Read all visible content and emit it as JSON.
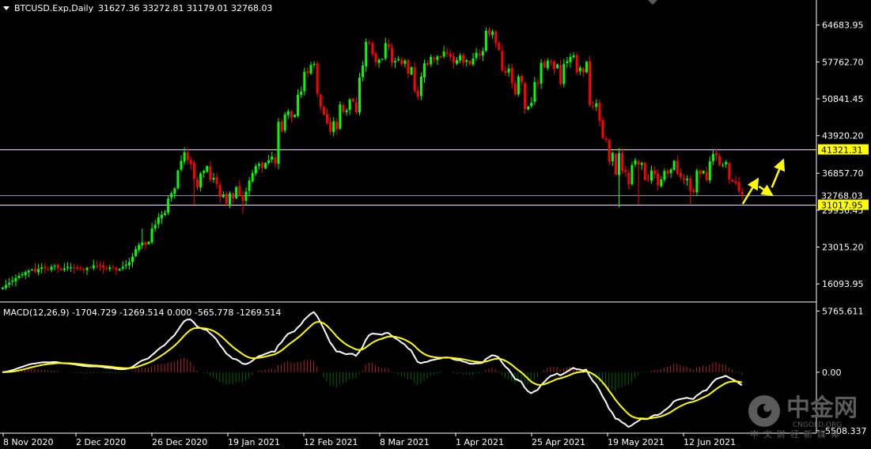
{
  "header": {
    "symbol": "BTCUSD.Exp,Daily",
    "ohlc": "31627.36 33272.81 31179.01 32768.03",
    "macd": "MACD(12,26,9) -1704.729 -1269.514 0.000 -565.778 -1269.514"
  },
  "watermark": {
    "name": "中金网",
    "domain": "CNGOLD.ORG",
    "tagline": "中文财经新媒体"
  },
  "colors": {
    "background": "#000000",
    "bull": "#00ff00",
    "bear": "#ff0000",
    "support_resistance": "#ffff00",
    "current_price_line": "#7f8fa6",
    "macd_main": "#ffffff",
    "macd_signal": "#ffff00",
    "hist_pos": "#b22222",
    "hist_neg": "#006400",
    "arrow": "#ffff00",
    "axis": "#ffffff"
  },
  "chart_data": [
    {
      "type": "candlestick",
      "title": "BTCUSD.Exp,Daily",
      "ylim": [
        13000,
        68500
      ],
      "y_ticks": [
        64683.95,
        57762.7,
        50841.45,
        43920.2,
        36857.7,
        29936.45,
        23015.2,
        16093.95
      ],
      "x_ticks": [
        "8 Nov 2020",
        "2 Dec 2020",
        "26 Dec 2020",
        "19 Jan 2021",
        "12 Feb 2021",
        "8 Mar 2021",
        "1 Apr 2021",
        "25 Apr 2021",
        "19 May 2021",
        "12 Jun 2021"
      ],
      "price_lines": [
        {
          "label": "41321.31",
          "value": 41321.31,
          "style": "highlight"
        },
        {
          "label": "32768.03",
          "value": 32768.03,
          "style": "current"
        },
        {
          "label": "31017.95",
          "value": 31017.95,
          "style": "highlight"
        }
      ],
      "closes": [
        15400,
        15900,
        16300,
        16700,
        17200,
        17600,
        17900,
        18300,
        18600,
        18800,
        18400,
        18900,
        19200,
        19000,
        18800,
        19300,
        19500,
        19100,
        18700,
        19000,
        19300,
        19200,
        19100,
        18900,
        19000,
        18700,
        19100,
        19200,
        19600,
        19500,
        19400,
        19100,
        18900,
        19200,
        19300,
        18700,
        18900,
        19300,
        19700,
        20200,
        21200,
        22600,
        23400,
        23800,
        23400,
        24000,
        26500,
        27200,
        28600,
        29100,
        29400,
        32100,
        33100,
        34000,
        37400,
        39200,
        40800,
        39300,
        38600,
        35800,
        34200,
        36800,
        37300,
        38200,
        35600,
        36000,
        34800,
        32400,
        32900,
        31200,
        33100,
        32100,
        34300,
        32800,
        31700,
        33400,
        35500,
        36900,
        38200,
        38600,
        37900,
        38800,
        39300,
        40000,
        38700,
        46500,
        44700,
        47900,
        48500,
        47300,
        47800,
        51600,
        52200,
        55900,
        55700,
        57200,
        57400,
        51800,
        49400,
        47900,
        46300,
        44700,
        46600,
        45100,
        49800,
        48400,
        48700,
        50700,
        50300,
        48300,
        54800,
        57100,
        61500,
        61200,
        59200,
        57700,
        58200,
        58300,
        61300,
        60500,
        57600,
        57900,
        58300,
        57400,
        58000,
        55600,
        56800,
        52300,
        51200,
        55000,
        57500,
        57200,
        58700,
        58200,
        58800,
        58600,
        59700,
        59300,
        58700,
        57600,
        58100,
        59000,
        57600,
        58100,
        57300,
        58400,
        59500,
        59000,
        59800,
        63600,
        62900,
        63500,
        61300,
        60000,
        56200,
        55700,
        56500,
        53800,
        51700,
        55000,
        54000,
        48900,
        49400,
        50100,
        54000,
        53700,
        57600,
        56800,
        58000,
        57800,
        56400,
        57300,
        53600,
        57400,
        57900,
        58700,
        59000,
        55800,
        56700,
        55800,
        57800,
        49700,
        49400,
        50000,
        46700,
        43500,
        43100,
        39000,
        40700,
        36600,
        40600,
        37300,
        37100,
        34800,
        38400,
        39300,
        38500,
        38800,
        35600,
        35600,
        37400,
        36700,
        34600,
        35700,
        37300,
        36700,
        37600,
        39200,
        36800,
        36100,
        35600,
        35800,
        33600,
        33400,
        37400,
        36700,
        37300,
        35600,
        39100,
        40500,
        40200,
        38400,
        38400,
        39000,
        35700,
        35300,
        35000,
        33500,
        32800
      ],
      "forecast_arrows": [
        {
          "from": [
            0,
            31100
          ],
          "to": [
            4,
            35100
          ]
        },
        {
          "from": [
            5,
            34400
          ],
          "to": [
            8,
            33200
          ]
        },
        {
          "from": [
            9,
            34200
          ],
          "to": [
            12,
            38600
          ]
        }
      ]
    },
    {
      "type": "macd",
      "title": "MACD(12,26,9)",
      "params": [
        12,
        26,
        9
      ],
      "ylim": [
        -5600,
        6400
      ],
      "y_ticks": [
        5765.611,
        0.0,
        -5508.337
      ],
      "main": -1704.729,
      "signal": -1269.514,
      "histogram": -565.778
    }
  ]
}
